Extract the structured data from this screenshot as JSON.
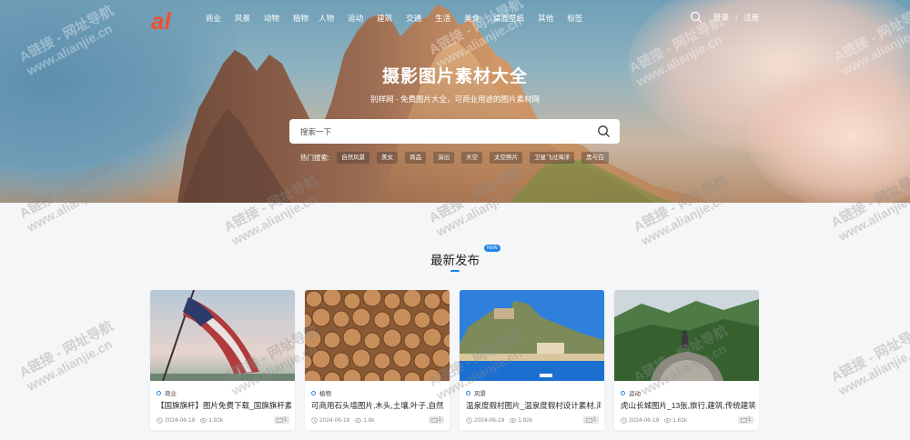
{
  "header": {
    "nav": [
      "商业",
      "风景",
      "动物",
      "植物",
      "人物",
      "运动",
      "建筑",
      "交通",
      "生活",
      "美食",
      "桌面壁纸",
      "其他",
      "标签"
    ],
    "login": "登录",
    "separator": "|",
    "register": "注册"
  },
  "hero": {
    "title": "摄影图片素材大全",
    "subtitle": "别样网 - 免费图片大全，可商业用途的图片素材网",
    "search_placeholder": "搜索一下",
    "hot_label": "热门搜索:",
    "hot_tags": [
      "自然风景",
      "美女",
      "商品",
      "演出",
      "天空",
      "太空照片",
      "卫星飞过海洋",
      "黑与白"
    ]
  },
  "section": {
    "title": "最新发布",
    "badge": "NEW"
  },
  "cards": [
    {
      "category": "商业",
      "title": "【国旗旗杆】图片免费下载_国旗旗杆素材",
      "date": "2024-06-19",
      "views": "1.92k",
      "pics": "1"
    },
    {
      "category": "植物",
      "title": "可商用石头墙图片,木头,土壤,叶子,自然",
      "date": "2024-06-19",
      "views": "1.8k",
      "pics": "1"
    },
    {
      "category": "风景",
      "title": "温泉度假村图片_温泉度假村设计素材,海景",
      "date": "2024-06-19",
      "views": "1.92k",
      "pics": "1"
    },
    {
      "category": "运动",
      "title": "虎山长城图片_13张,旅行,建筑,传统建筑",
      "date": "2024-06-19",
      "views": "1.61k",
      "pics": "1"
    }
  ],
  "watermark": {
    "line1": "A链接 - 网址导航",
    "line2": "www.alianjie.cn"
  },
  "colors": {
    "accent": "#1f86e5",
    "logo": "#f0502e"
  }
}
